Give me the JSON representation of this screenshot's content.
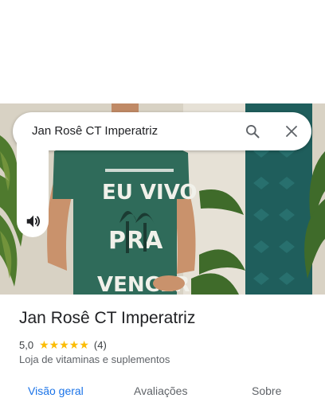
{
  "search": {
    "query": "Jan Rosê CT Imperatriz"
  },
  "media": {
    "shirt_print": [
      "EU VIVO",
      "PRA",
      "VENCER"
    ]
  },
  "place": {
    "title": "Jan Rosê CT Imperatriz",
    "rating": "5,0",
    "stars": 5,
    "review_count": "(4)",
    "category": "Loja de vitaminas e suplementos"
  },
  "tabs": [
    {
      "label": "Visão geral",
      "active": true
    },
    {
      "label": "Avaliações",
      "active": false
    },
    {
      "label": "Sobre",
      "active": false
    }
  ],
  "colors": {
    "accent": "#1a73e8",
    "star": "#fbbc04",
    "shirt": "#2f6b5a",
    "wall_panel": "#1f5e5c"
  },
  "icons": [
    "search-icon",
    "close-icon",
    "volume-icon",
    "star-icon"
  ]
}
